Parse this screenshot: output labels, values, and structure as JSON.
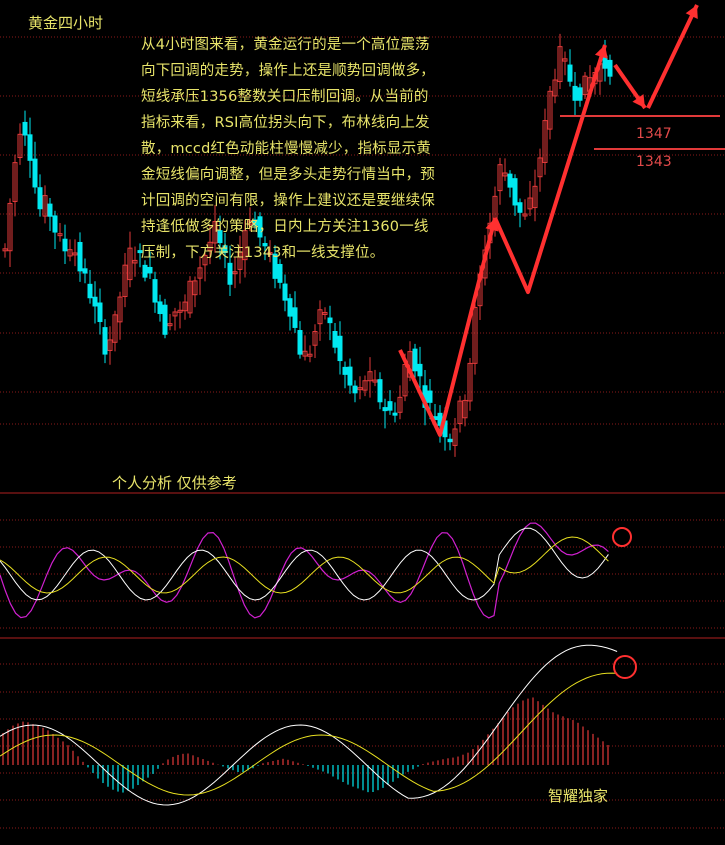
{
  "title": "黄金四小时",
  "analysis": "从4小时图来看，黄金运行的是一个高位震荡向下回调的走势，操作上还是顺势回调做多，短线承压1356整数关口压制回调。从当前的指标来看，RSI高位拐头向下，布林线向上发散，mccd红色动能柱慢慢减少，指标显示黄金短线偏向调整，但是多头走势行情当中，预计回调的空间有限，操作上建议还是要继续保持逢低做多的策略，日内上方关注1360一线压制，下方关注1343和一线支撑位。",
  "disclaimer": "个人分析 仅供参考",
  "signature": "智耀独家",
  "levels": [
    "1347",
    "1343"
  ],
  "colors": {
    "up_candle": "#e23a3a",
    "down_candle": "#00e8f0",
    "grid": "#8a1a1a",
    "arrow": "#ff3030",
    "text": "#e8e46a",
    "rsi_fast": "#d020d0",
    "line_white": "#ffffff",
    "line_yellow": "#e8e020"
  },
  "chart_data": {
    "type": "candlestick",
    "panels": [
      "price",
      "rsi",
      "macd"
    ],
    "candles_trend": [
      0.5,
      0.7,
      0.85,
      0.75,
      0.6,
      0.62,
      0.55,
      0.5,
      0.52,
      0.45,
      0.4,
      0.32,
      0.25,
      0.3,
      0.42,
      0.5,
      0.48,
      0.44,
      0.38,
      0.3,
      0.35,
      0.33,
      0.4,
      0.45,
      0.5,
      0.55,
      0.48,
      0.42,
      0.5,
      0.6,
      0.55,
      0.5,
      0.45,
      0.4,
      0.35,
      0.25,
      0.22,
      0.3,
      0.35,
      0.28,
      0.2,
      0.15,
      0.12,
      0.18,
      0.15,
      0.1,
      0.08,
      0.12,
      0.25,
      0.2,
      0.12,
      0.08,
      0.05,
      0.02,
      0.08,
      0.15,
      0.35,
      0.5,
      0.6,
      0.72,
      0.68,
      0.6,
      0.58,
      0.66,
      0.78,
      0.92,
      1.0,
      0.95,
      0.9,
      0.92,
      0.95,
      0.98,
      0.97
    ],
    "macd_histogram": [
      0.4,
      0.5,
      0.55,
      0.5,
      0.45,
      0.35,
      0.25,
      0.1,
      -0.05,
      -0.2,
      -0.3,
      -0.35,
      -0.3,
      -0.2,
      -0.1,
      0.05,
      0.12,
      0.15,
      0.1,
      0.05,
      0.0,
      -0.05,
      -0.1,
      -0.05,
      0.02,
      0.05,
      0.08,
      0.04,
      0.0,
      -0.05,
      -0.1,
      -0.18,
      -0.25,
      -0.3,
      -0.35,
      -0.3,
      -0.22,
      -0.12,
      -0.05,
      0.02,
      0.05,
      0.08,
      0.1,
      0.15,
      0.25,
      0.4,
      0.55,
      0.7,
      0.8,
      0.85,
      0.75,
      0.65,
      0.6,
      0.55,
      0.45,
      0.35,
      0.25
    ]
  }
}
